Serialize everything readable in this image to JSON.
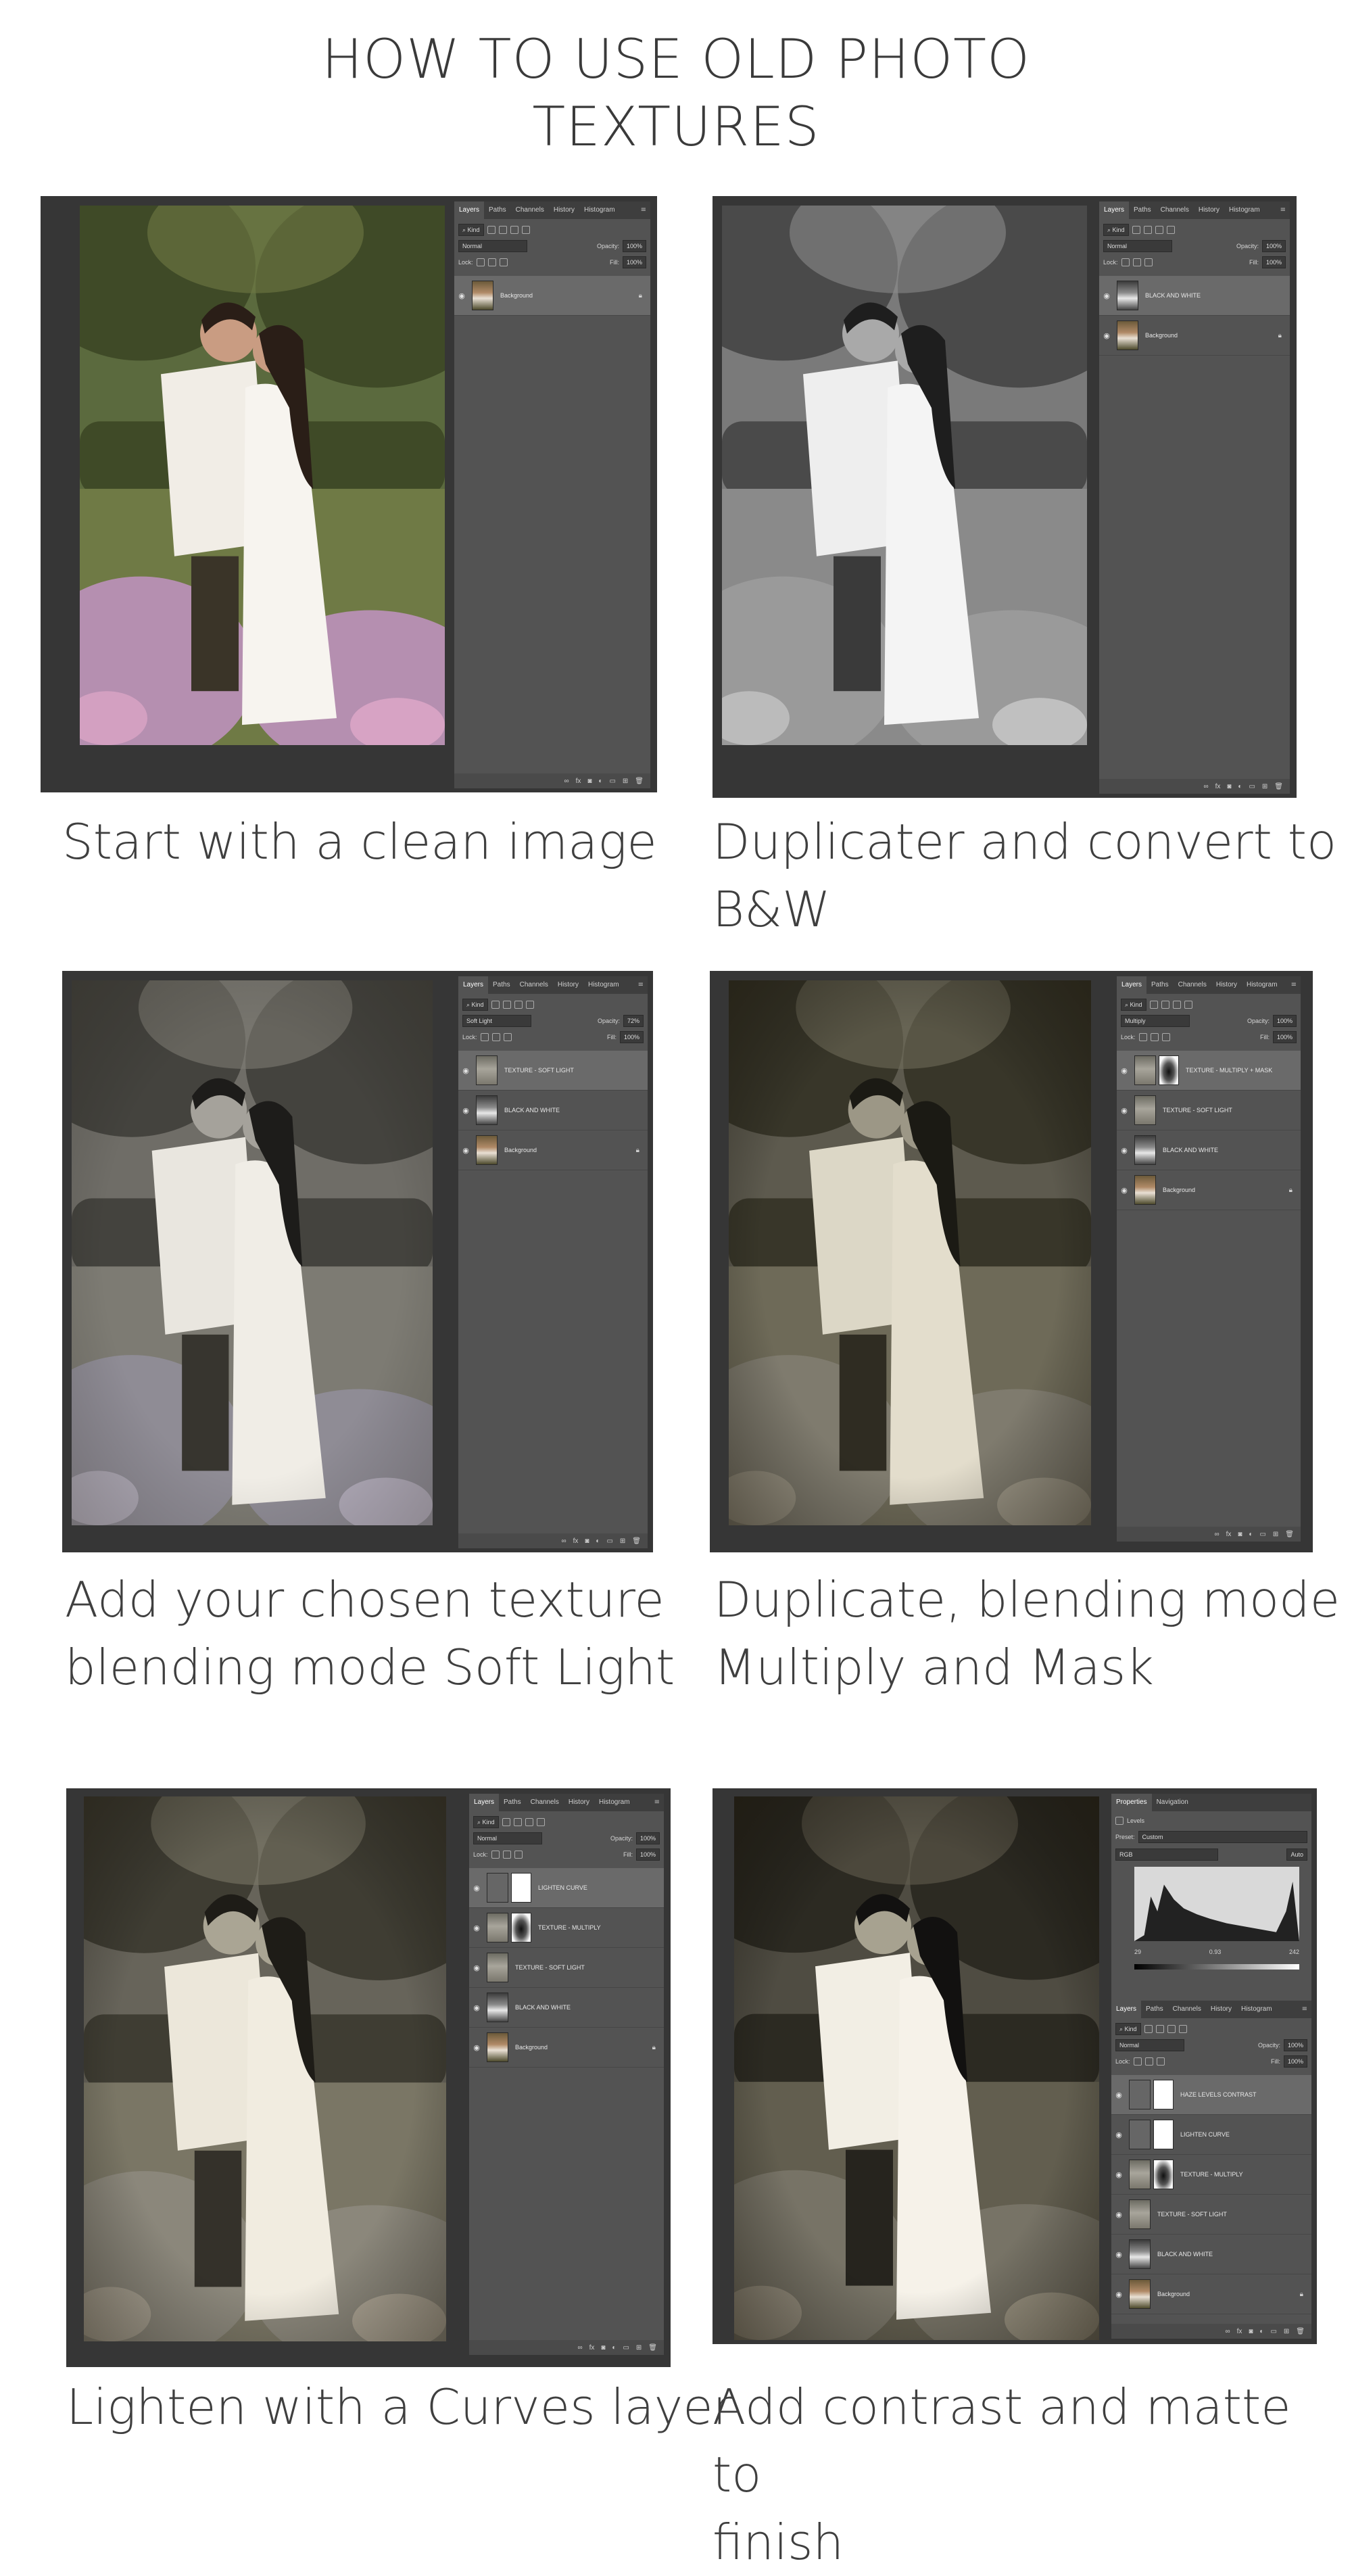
{
  "title_line1": "HOW TO USE OLD PHOTO",
  "title_line2": "TEXTURES",
  "tabs": [
    "Layers",
    "Paths",
    "Channels",
    "History",
    "Histogram"
  ],
  "panel": {
    "kind": "Kind",
    "lock_label": "Lock:",
    "opacity_label": "Opacity:",
    "fill_label": "Fill:",
    "menu_icon": "hamburger-menu-icon",
    "lock_icon": "lock-icon",
    "eye_icon": "eye-icon",
    "footer_icons": "link fx mask adjust folder new trash"
  },
  "steps": [
    {
      "caption": [
        "Start with a clean image"
      ],
      "blend": "Normal",
      "opacity": "100%",
      "fill": "100%",
      "layers": [
        {
          "name": "Background",
          "locked": true,
          "selected": true,
          "thumb": "color"
        }
      ]
    },
    {
      "caption": [
        "Duplicater and convert to",
        "B&W"
      ],
      "blend": "Normal",
      "opacity": "100%",
      "fill": "100%",
      "layers": [
        {
          "name": "BLACK AND WHITE",
          "selected": true,
          "thumb": "bw"
        },
        {
          "name": "Background",
          "locked": true,
          "thumb": "color"
        }
      ]
    },
    {
      "caption": [
        "Add your chosen texture",
        "blending mode Soft Light"
      ],
      "blend": "Soft Light",
      "opacity": "72%",
      "fill": "100%",
      "layers": [
        {
          "name": "TEXTURE - SOFT LIGHT",
          "selected": true,
          "thumb": "tex"
        },
        {
          "name": "BLACK AND WHITE",
          "thumb": "bw"
        },
        {
          "name": "Background",
          "locked": true,
          "thumb": "color"
        }
      ]
    },
    {
      "caption": [
        "Duplicate, blending mode",
        "Multiply and Mask"
      ],
      "blend": "Multiply",
      "opacity": "100%",
      "fill": "100%",
      "layers": [
        {
          "name": "TEXTURE - MULTIPLY + MASK",
          "selected": true,
          "thumb": "tex",
          "mask": "dark"
        },
        {
          "name": "TEXTURE - SOFT LIGHT",
          "thumb": "tex"
        },
        {
          "name": "BLACK AND WHITE",
          "thumb": "bw"
        },
        {
          "name": "Background",
          "locked": true,
          "thumb": "color"
        }
      ]
    },
    {
      "caption": [
        "Lighten with a Curves layer"
      ],
      "blend": "Normal",
      "opacity": "100%",
      "fill": "100%",
      "layers": [
        {
          "name": "LIGHTEN CURVE",
          "selected": true,
          "thumb": "curve",
          "mask": "white"
        },
        {
          "name": "TEXTURE - MULTIPLY",
          "thumb": "tex",
          "mask": "dark"
        },
        {
          "name": "TEXTURE - SOFT LIGHT",
          "thumb": "tex"
        },
        {
          "name": "BLACK AND WHITE",
          "thumb": "bw"
        },
        {
          "name": "Background",
          "locked": true,
          "thumb": "color"
        }
      ]
    },
    {
      "caption": [
        "Add contrast and matte to",
        "finish"
      ],
      "blend": "Normal",
      "opacity": "100%",
      "fill": "100%",
      "layers": [
        {
          "name": "HAZE LEVELS CONTRAST",
          "selected": true,
          "thumb": "curve",
          "mask": "white"
        },
        {
          "name": "LIGHTEN CURVE",
          "thumb": "curve",
          "mask": "white"
        },
        {
          "name": "TEXTURE - MULTIPLY",
          "thumb": "tex",
          "mask": "dark"
        },
        {
          "name": "TEXTURE - SOFT LIGHT",
          "thumb": "tex"
        },
        {
          "name": "BLACK AND WHITE",
          "thumb": "bw"
        },
        {
          "name": "Background",
          "locked": true,
          "thumb": "color"
        }
      ]
    }
  ],
  "properties": {
    "tabs": [
      "Properties",
      "Navigation"
    ],
    "adjustment": "Levels",
    "preset_label": "Preset:",
    "preset": "Custom",
    "channel": "RGB",
    "auto": "Auto",
    "input_black": "29",
    "input_gamma": "0.93",
    "input_white": "242"
  }
}
